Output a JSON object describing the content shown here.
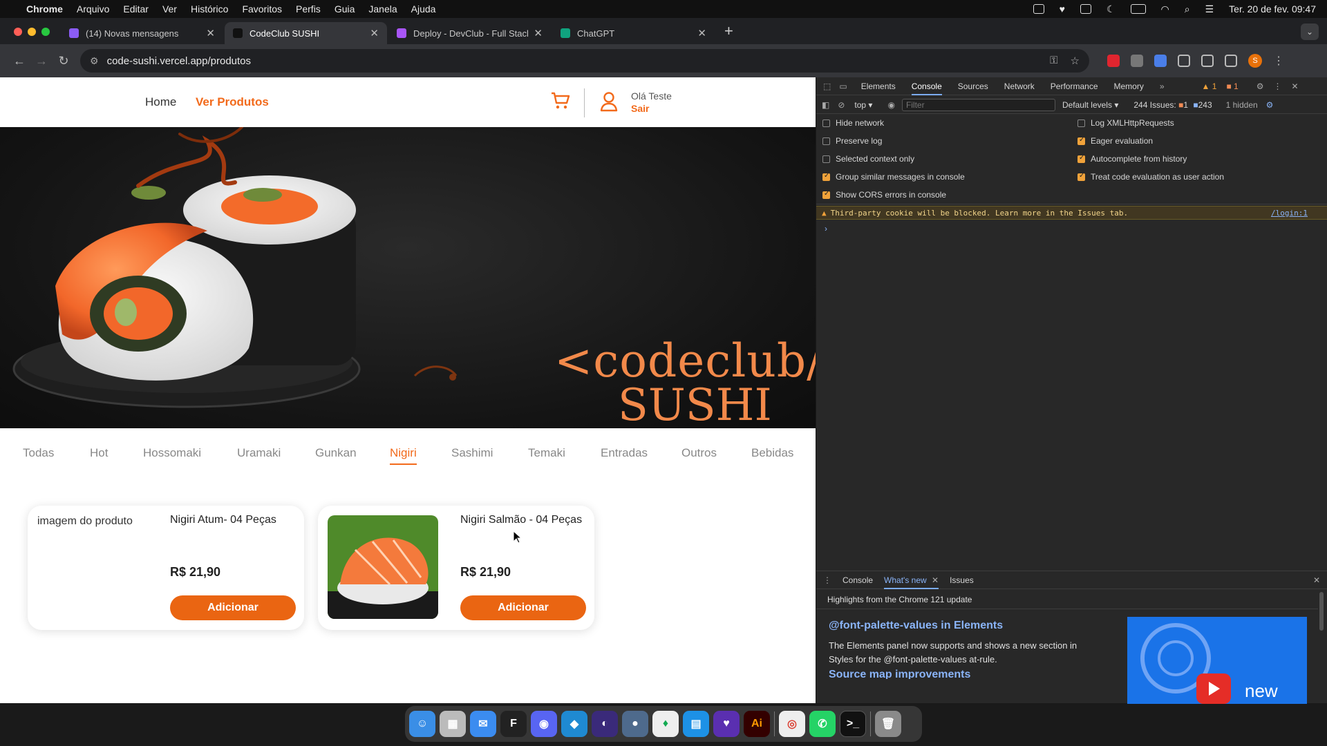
{
  "menubar": {
    "app": "Chrome",
    "items": [
      "Arquivo",
      "Editar",
      "Ver",
      "Histórico",
      "Favoritos",
      "Perfis",
      "Guia",
      "Janela",
      "Ajuda"
    ],
    "clock": "Ter. 20 de fev.  09:47"
  },
  "tabs": [
    {
      "title": "(14) Novas mensagens",
      "color": "#8b5cf6"
    },
    {
      "title": "CodeClub SUSHI",
      "color": "#111111"
    },
    {
      "title": "Deploy - DevClub - Full Stack",
      "color": "#a855f7"
    },
    {
      "title": "ChatGPT",
      "color": "#10a37f"
    }
  ],
  "toolbar": {
    "url": "code-sushi.vercel.app/produtos"
  },
  "site": {
    "nav": {
      "home": "Home",
      "products": "Ver Produtos"
    },
    "user": {
      "greeting": "Olá Teste",
      "logout": "Sair"
    },
    "hero": {
      "brand_line1": "<codeclub/>",
      "brand_line2": "SUSHI"
    },
    "categories": [
      "Todas",
      "Hot",
      "Hossomaki",
      "Uramaki",
      "Gunkan",
      "Nigiri",
      "Sashimi",
      "Temaki",
      "Entradas",
      "Outros",
      "Bebidas"
    ],
    "active_category": "Nigiri",
    "products": [
      {
        "name": "Nigiri Atum- 04 Peças",
        "price": "R$ 21,90",
        "button": "Adicionar",
        "img_alt": "imagem do produto"
      },
      {
        "name": "Nigiri Salmão - 04 Peças",
        "price": "R$ 21,90",
        "button": "Adicionar"
      }
    ],
    "accent": "#f26a1b"
  },
  "devtools": {
    "tabs": [
      "Elements",
      "Console",
      "Sources",
      "Network",
      "Performance",
      "Memory"
    ],
    "active_tab": "Console",
    "badges": {
      "warnings": "1",
      "errors": "1"
    },
    "context": "top",
    "filter_placeholder": "Filter",
    "levels": "Default levels",
    "issues": {
      "label": "244 Issues:",
      "a": "1",
      "b": "243",
      "hidden": "1 hidden"
    },
    "settings_left": [
      {
        "label": "Hide network",
        "checked": false
      },
      {
        "label": "Preserve log",
        "checked": false
      },
      {
        "label": "Selected context only",
        "checked": false
      },
      {
        "label": "Group similar messages in console",
        "checked": true
      },
      {
        "label": "Show CORS errors in console",
        "checked": true
      }
    ],
    "settings_right": [
      {
        "label": "Log XMLHttpRequests",
        "checked": false
      },
      {
        "label": "Eager evaluation",
        "checked": true
      },
      {
        "label": "Autocomplete from history",
        "checked": true
      },
      {
        "label": "Treat code evaluation as user action",
        "checked": true
      }
    ],
    "warning": "Third-party cookie will be blocked. Learn more in the Issues tab.",
    "warning_source": "/login:1",
    "drawer": {
      "tabs": [
        "Console",
        "What's new",
        "Issues"
      ],
      "active": "What's new",
      "highlight": "Highlights from the Chrome 121 update",
      "feature_title": "@font-palette-values in Elements",
      "feature_text": "The Elements panel now supports and shows a new section in Styles for the @font-palette-values at-rule.",
      "next_title": "Source map improvements",
      "video_label": "new"
    }
  },
  "dock": [
    "finder",
    "launchpad",
    "mail",
    "figma",
    "discord",
    "vscode",
    "arc",
    "tableplus",
    "mongodb",
    "docker",
    "obsidian",
    "illustrator",
    "chrome",
    "whatsapp",
    "terminal",
    "trash"
  ]
}
